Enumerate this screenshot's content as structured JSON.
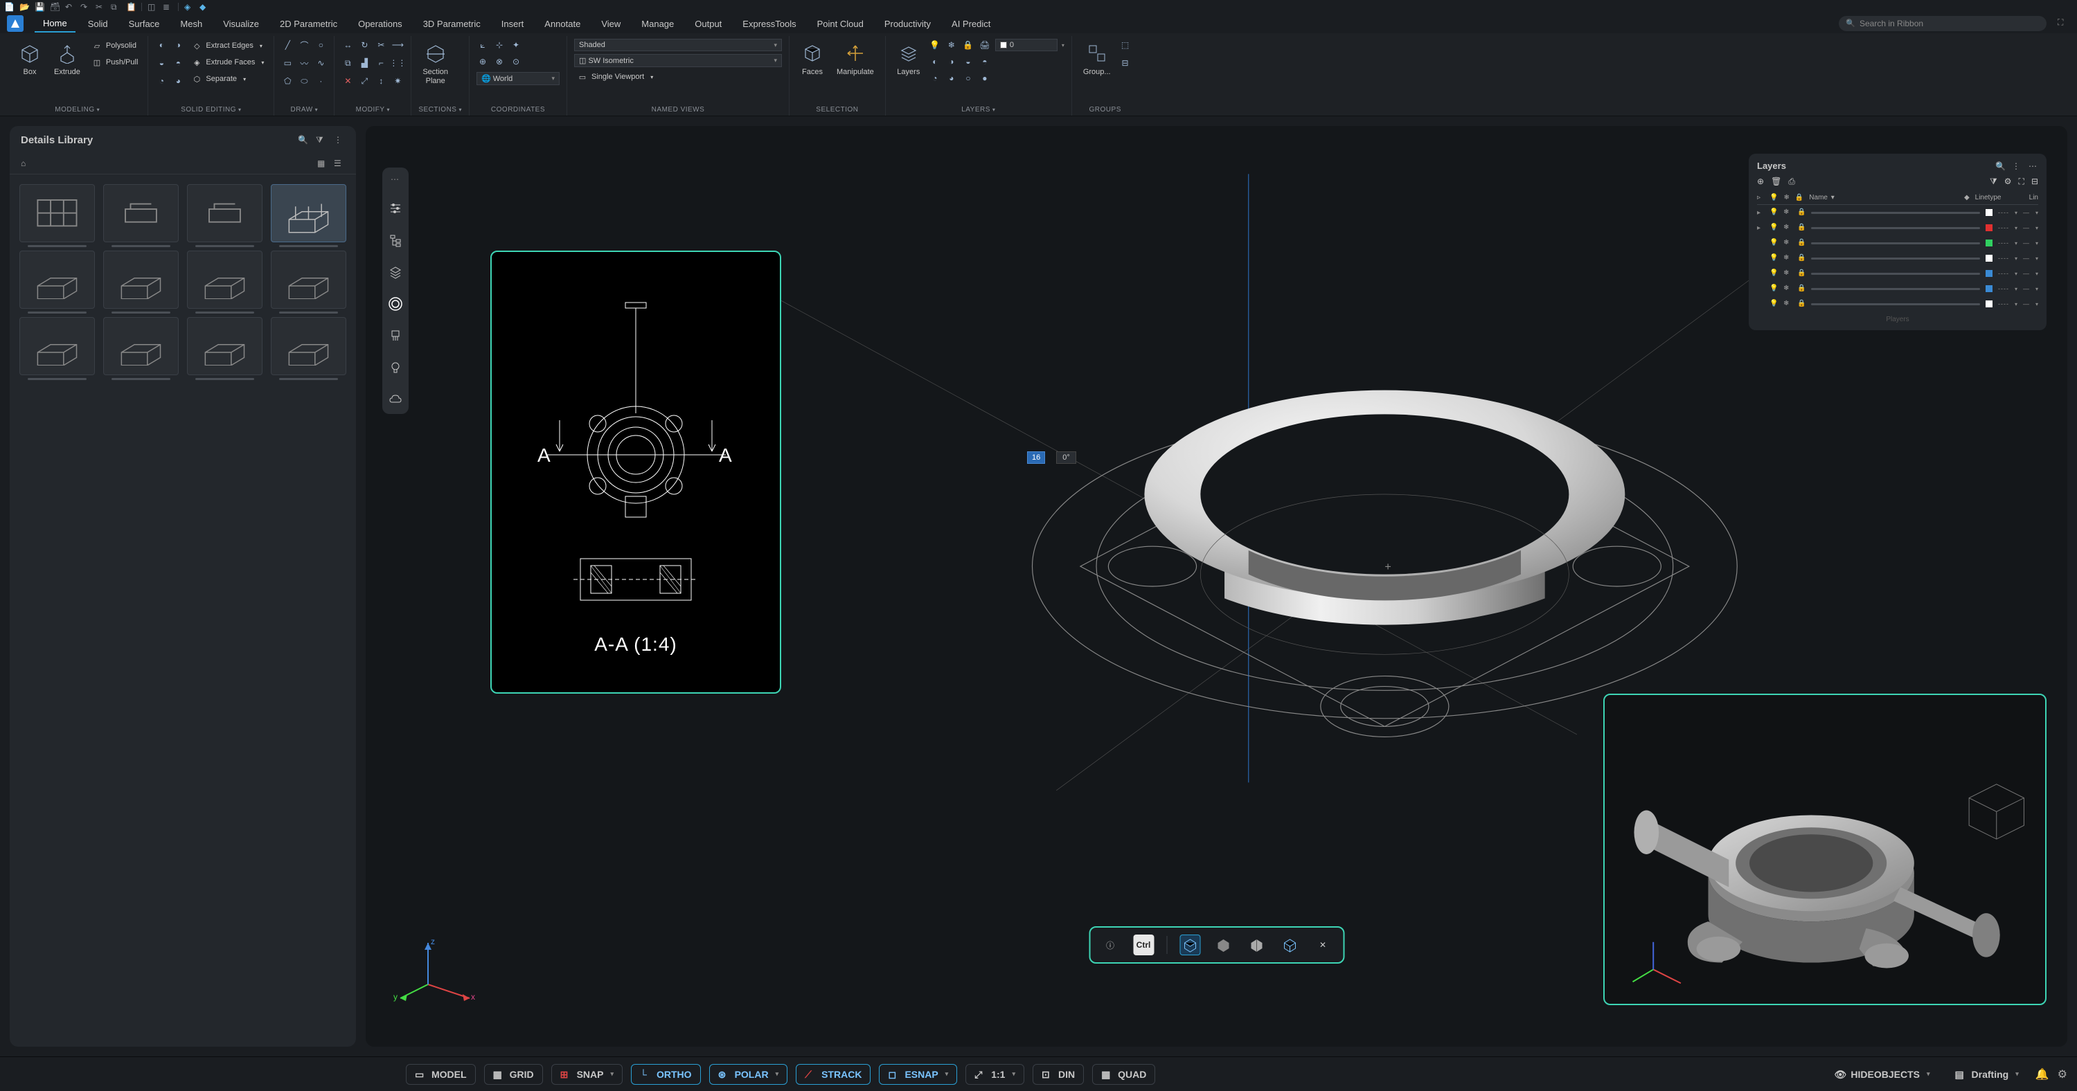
{
  "qat_icons": [
    "new-file",
    "open",
    "save",
    "save-all",
    "undo",
    "redo",
    "cut",
    "copy",
    "paste",
    "sep",
    "cube",
    "layers",
    "sep",
    "wireframe",
    "shaded"
  ],
  "tabs": [
    "Home",
    "Solid",
    "Surface",
    "Mesh",
    "Visualize",
    "2D Parametric",
    "Operations",
    "3D Parametric",
    "Insert",
    "Annotate",
    "View",
    "Manage",
    "Output",
    "ExpressTools",
    "Point Cloud",
    "Productivity",
    "AI Predict"
  ],
  "active_tab": "Home",
  "search_placeholder": "Search in Ribbon",
  "ribbon": {
    "modeling": {
      "title": "MODELING",
      "box": "Box",
      "extrude": "Extrude",
      "polysolid": "Polysolid",
      "pushpull": "Push/Pull"
    },
    "solid_editing": {
      "title": "SOLID EDITING",
      "extract_edges": "Extract Edges",
      "extrude_faces": "Extrude Faces",
      "separate": "Separate"
    },
    "draw": {
      "title": "DRAW"
    },
    "modify": {
      "title": "MODIFY"
    },
    "sections": {
      "title": "SECTIONS",
      "section_plane": "Section\nPlane"
    },
    "coordinates": {
      "title": "COORDINATES",
      "world": "World"
    },
    "named_views": {
      "title": "NAMED VIEWS",
      "visual_style": "Shaded",
      "view": "SW Isometric",
      "viewport": "Single Viewport"
    },
    "selection": {
      "title": "SELECTION",
      "faces": "Faces",
      "manipulate": "Manipulate"
    },
    "layers": {
      "title": "LAYERS",
      "layers": "Layers",
      "current": "0"
    },
    "groups": {
      "title": "GROUPS",
      "group": "Group..."
    }
  },
  "details_panel": {
    "title": "Details Library"
  },
  "section_view": {
    "label": "A-A (1:4)",
    "left_marker": "A",
    "right_marker": "A"
  },
  "ctrl_key": "Ctrl",
  "anno": {
    "val": "16",
    "ang": "0°"
  },
  "layers_panel": {
    "title": "Layers",
    "cols": {
      "name": "Name",
      "linetype": "Linetype",
      "lin": "Lin"
    },
    "rows": [
      {
        "color": "#ffffff"
      },
      {
        "color": "#e03030"
      },
      {
        "color": "#30d060"
      },
      {
        "color": "#ffffff"
      },
      {
        "color": "#3a8ad4"
      },
      {
        "color": "#3a8ad4"
      },
      {
        "color": "#ffffff"
      }
    ]
  },
  "status": {
    "model": "MODEL",
    "grid": "GRID",
    "snap": "SNAP",
    "ortho": "ORTHO",
    "polar": "POLAR",
    "strack": "STRACK",
    "esnap": "ESNAP",
    "scale": "1:1",
    "din": "DIN",
    "quad": "QUAD",
    "hideobjects": "HIDEOBJECTS",
    "drafting": "Drafting"
  },
  "ucs": {
    "x": "x",
    "y": "y",
    "z": "z"
  },
  "layers_footer": "Players"
}
